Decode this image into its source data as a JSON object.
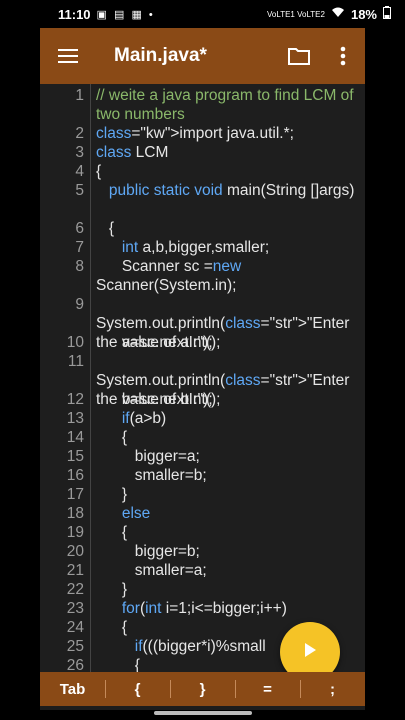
{
  "status_bar": {
    "time": "11:10",
    "left_icons": "▣ ▤ ▦ •",
    "signal_text": "VoLTE1 VoLTE2",
    "battery": "18%"
  },
  "app_bar": {
    "title": "Main.java*",
    "menu_icon": "hamburger-icon",
    "folder_icon": "folder-icon",
    "more_icon": "more-vert-icon",
    "color": "#8a4a16"
  },
  "editor": {
    "lines": [
      {
        "n": "1",
        "text": "// weite a java program to find LCM of two numbers"
      },
      {
        "n": "2",
        "text": "import java.util.*;"
      },
      {
        "n": "3",
        "text": "class LCM"
      },
      {
        "n": "4",
        "text": "{"
      },
      {
        "n": "5",
        "text": "   public static void main(String []args)"
      },
      {
        "n": "6",
        "text": "   {"
      },
      {
        "n": "7",
        "text": "      int a,b,bigger,smaller;"
      },
      {
        "n": "8",
        "text": "      Scanner sc =new Scanner(System.in);"
      },
      {
        "n": "9",
        "text": "      System.out.println(\"Enter the value of a :\");"
      },
      {
        "n": "10",
        "text": "      a=sc.nextInt();"
      },
      {
        "n": "11",
        "text": "      System.out.println(\"Enter the value of b :\");"
      },
      {
        "n": "12",
        "text": "      b=sc.nextInt();"
      },
      {
        "n": "13",
        "text": "      if(a>b)"
      },
      {
        "n": "14",
        "text": "      {"
      },
      {
        "n": "15",
        "text": "         bigger=a;"
      },
      {
        "n": "16",
        "text": "         smaller=b;"
      },
      {
        "n": "17",
        "text": "      }"
      },
      {
        "n": "18",
        "text": "      else"
      },
      {
        "n": "19",
        "text": "      {"
      },
      {
        "n": "20",
        "text": "         bigger=b;"
      },
      {
        "n": "21",
        "text": "         smaller=a;"
      },
      {
        "n": "22",
        "text": "      }"
      },
      {
        "n": "23",
        "text": "      for(int i=1;i<=bigger;i++)"
      },
      {
        "n": "24",
        "text": "      {"
      },
      {
        "n": "25",
        "text": "         if(((bigger*i)%small"
      },
      {
        "n": "26",
        "text": "         {"
      }
    ]
  },
  "fab": {
    "icon": "play-icon",
    "color": "#f5c326"
  },
  "key_bar": {
    "keys": [
      "Tab",
      "{",
      "}",
      "=",
      ";"
    ]
  }
}
